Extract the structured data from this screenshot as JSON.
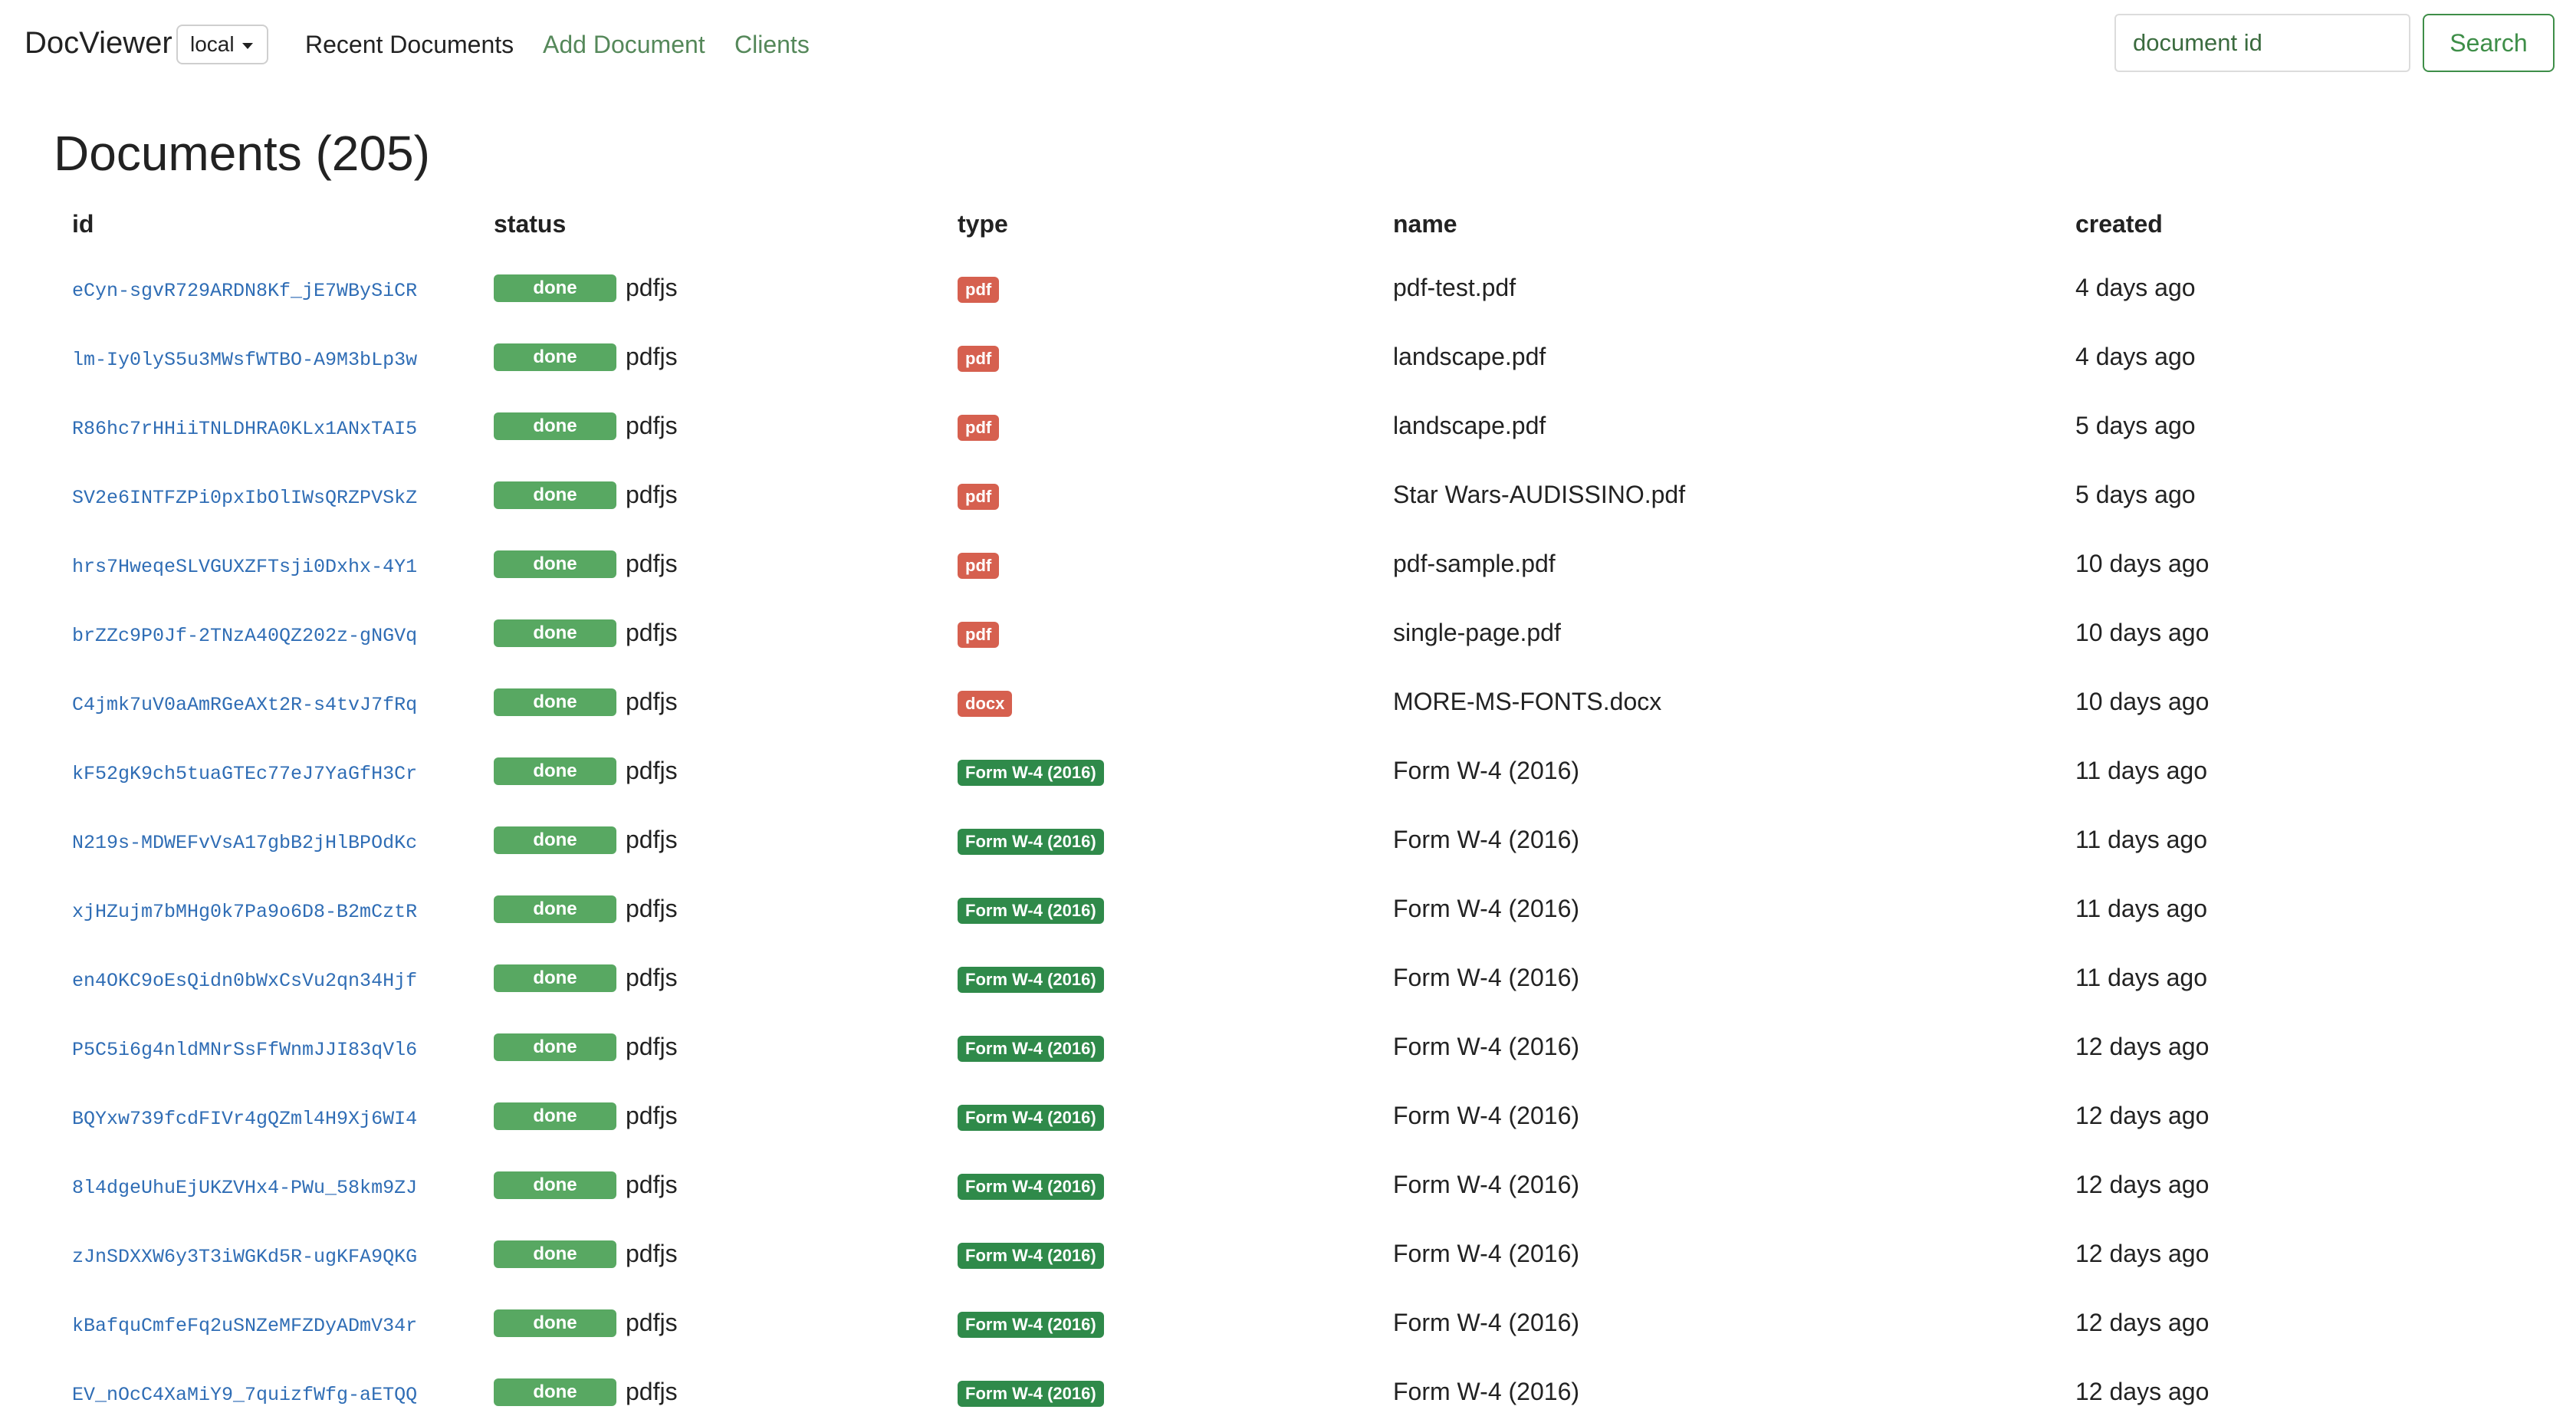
{
  "navbar": {
    "brand": "DocViewer",
    "env_selected": "local",
    "links": [
      "Recent Documents",
      "Add Document",
      "Clients"
    ],
    "search_placeholder": "document id",
    "search_button": "Search"
  },
  "page_title": "Documents (205)",
  "table": {
    "headers": [
      "id",
      "status",
      "type",
      "name",
      "created"
    ],
    "rows": [
      {
        "id": "eCyn-sgvR729ARDN8Kf_jE7WBySiCR",
        "status": "done",
        "engine": "pdfjs",
        "type": "pdf",
        "type_style": "pdf",
        "name": "pdf-test.pdf",
        "created": "4 days ago"
      },
      {
        "id": "lm-Iy0lyS5u3MWsfWTBO-A9M3bLp3w",
        "status": "done",
        "engine": "pdfjs",
        "type": "pdf",
        "type_style": "pdf",
        "name": "landscape.pdf",
        "created": "4 days ago"
      },
      {
        "id": "R86hc7rHHiiTNLDHRA0KLx1ANxTAI5",
        "status": "done",
        "engine": "pdfjs",
        "type": "pdf",
        "type_style": "pdf",
        "name": "landscape.pdf",
        "created": "5 days ago"
      },
      {
        "id": "SV2e6INTFZPi0pxIbOlIWsQRZPVSkZ",
        "status": "done",
        "engine": "pdfjs",
        "type": "pdf",
        "type_style": "pdf",
        "name": "Star Wars-AUDISSINO.pdf",
        "created": "5 days ago"
      },
      {
        "id": "hrs7HweqeSLVGUXZFTsji0Dxhx-4Y1",
        "status": "done",
        "engine": "pdfjs",
        "type": "pdf",
        "type_style": "pdf",
        "name": "pdf-sample.pdf",
        "created": "10 days ago"
      },
      {
        "id": "brZZc9P0Jf-2TNzA40QZ202z-gNGVq",
        "status": "done",
        "engine": "pdfjs",
        "type": "pdf",
        "type_style": "pdf",
        "name": "single-page.pdf",
        "created": "10 days ago"
      },
      {
        "id": "C4jmk7uV0aAmRGeAXt2R-s4tvJ7fRq",
        "status": "done",
        "engine": "pdfjs",
        "type": "docx",
        "type_style": "docx",
        "name": "MORE-MS-FONTS.docx",
        "created": "10 days ago"
      },
      {
        "id": "kF52gK9ch5tuaGTEc77eJ7YaGfH3Cr",
        "status": "done",
        "engine": "pdfjs",
        "type": "Form W-4 (2016)",
        "type_style": "form",
        "name": "Form W-4 (2016)",
        "created": "11 days ago"
      },
      {
        "id": "N219s-MDWEFvVsA17gbB2jHlBPOdKc",
        "status": "done",
        "engine": "pdfjs",
        "type": "Form W-4 (2016)",
        "type_style": "form",
        "name": "Form W-4 (2016)",
        "created": "11 days ago"
      },
      {
        "id": "xjHZujm7bMHg0k7Pa9o6D8-B2mCztR",
        "status": "done",
        "engine": "pdfjs",
        "type": "Form W-4 (2016)",
        "type_style": "form",
        "name": "Form W-4 (2016)",
        "created": "11 days ago"
      },
      {
        "id": "en4OKC9oEsQidn0bWxCsVu2qn34Hjf",
        "status": "done",
        "engine": "pdfjs",
        "type": "Form W-4 (2016)",
        "type_style": "form",
        "name": "Form W-4 (2016)",
        "created": "11 days ago"
      },
      {
        "id": "P5C5i6g4nldMNrSsFfWnmJJI83qVl6",
        "status": "done",
        "engine": "pdfjs",
        "type": "Form W-4 (2016)",
        "type_style": "form",
        "name": "Form W-4 (2016)",
        "created": "12 days ago"
      },
      {
        "id": "BQYxw739fcdFIVr4gQZml4H9Xj6WI4",
        "status": "done",
        "engine": "pdfjs",
        "type": "Form W-4 (2016)",
        "type_style": "form",
        "name": "Form W-4 (2016)",
        "created": "12 days ago"
      },
      {
        "id": "8l4dgeUhuEjUKZVHx4-PWu_58km9ZJ",
        "status": "done",
        "engine": "pdfjs",
        "type": "Form W-4 (2016)",
        "type_style": "form",
        "name": "Form W-4 (2016)",
        "created": "12 days ago"
      },
      {
        "id": "zJnSDXXW6y3T3iWGKd5R-ugKFA9QKG",
        "status": "done",
        "engine": "pdfjs",
        "type": "Form W-4 (2016)",
        "type_style": "form",
        "name": "Form W-4 (2016)",
        "created": "12 days ago"
      },
      {
        "id": "kBafquCmfeFq2uSNZeMFZDyADmV34r",
        "status": "done",
        "engine": "pdfjs",
        "type": "Form W-4 (2016)",
        "type_style": "form",
        "name": "Form W-4 (2016)",
        "created": "12 days ago"
      },
      {
        "id": "EV_nOcC4XaMiY9_7quizfWfg-aETQQ",
        "status": "done",
        "engine": "pdfjs",
        "type": "Form W-4 (2016)",
        "type_style": "form",
        "name": "Form W-4 (2016)",
        "created": "12 days ago"
      }
    ]
  },
  "colors": {
    "link_green": "#55885a",
    "button_green": "#3e8e48",
    "status_done": "#58a862",
    "type_pdf": "#d6604f",
    "type_form": "#2f8a4a",
    "id_link": "#2f6db5"
  }
}
